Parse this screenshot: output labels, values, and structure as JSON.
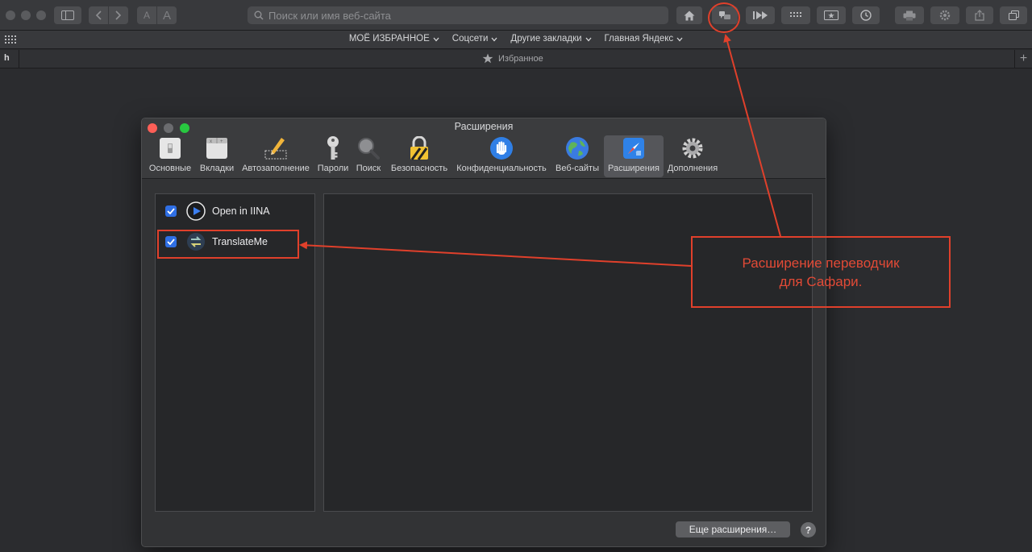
{
  "browser": {
    "search_placeholder": "Поиск или имя веб-сайта",
    "font_smaller_label": "A",
    "font_larger_label": "A"
  },
  "favorites_bar": {
    "items": [
      {
        "label": "МОЁ ИЗБРАННОЕ"
      },
      {
        "label": "Соцсети"
      },
      {
        "label": "Другие закладки"
      },
      {
        "label": "Главная Яндекс"
      }
    ]
  },
  "tab_bar": {
    "first_tab_label": "h",
    "active_tab_label": "Избранное",
    "new_tab_label": "+"
  },
  "prefs_window": {
    "title": "Расширения",
    "tabs": [
      {
        "label": "Основные",
        "icon": "switch-icon"
      },
      {
        "label": "Вкладки",
        "icon": "tabs-icon"
      },
      {
        "label": "Автозаполнение",
        "icon": "pencil-icon"
      },
      {
        "label": "Пароли",
        "icon": "key-icon"
      },
      {
        "label": "Поиск",
        "icon": "magnifier-icon"
      },
      {
        "label": "Безопасность",
        "icon": "lock-icon"
      },
      {
        "label": "Конфиденциальность",
        "icon": "hand-icon"
      },
      {
        "label": "Веб-сайты",
        "icon": "globe-icon"
      },
      {
        "label": "Расширения",
        "icon": "puzzle-icon"
      },
      {
        "label": "Дополнения",
        "icon": "gear-icon"
      }
    ],
    "active_tab": "Расширения",
    "extensions": [
      {
        "name": "Open in IINA",
        "enabled": true,
        "icon": "iina-play-icon"
      },
      {
        "name": "TranslateMe",
        "enabled": true,
        "icon": "translate-icon"
      }
    ],
    "more_button_label": "Еще расширения…",
    "help_label": "?"
  },
  "annotation": {
    "line1": "Расширение переводчик",
    "line2": "для Сафари.",
    "color": "#e0402b"
  }
}
